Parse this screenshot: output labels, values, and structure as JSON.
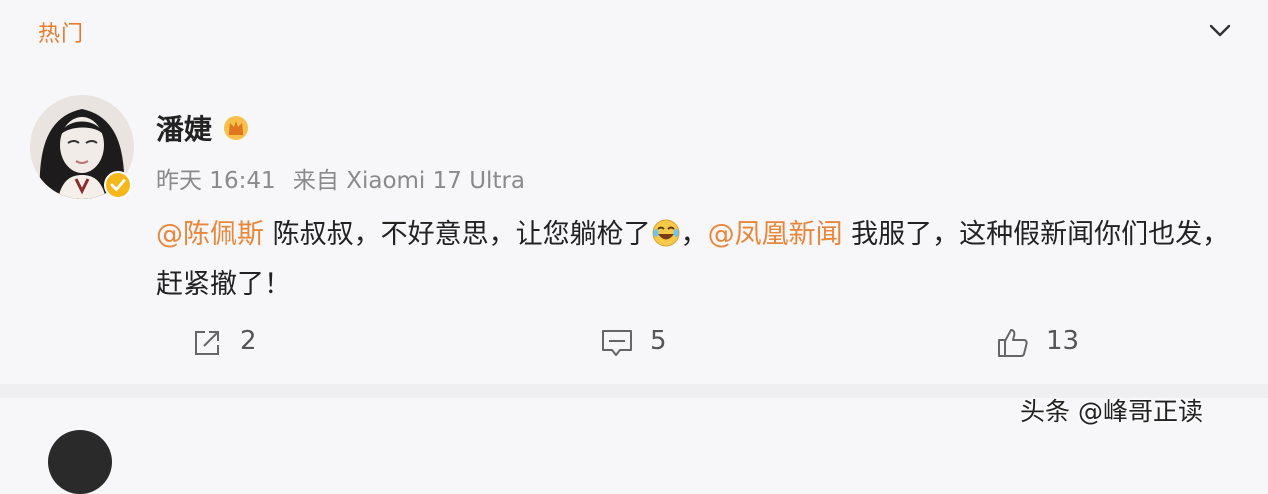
{
  "tabs": {
    "hot_label": "热门"
  },
  "post": {
    "username": "潘婕",
    "time": "昨天 16:41",
    "source": "来自 Xiaomi 17 Ultra",
    "segments": [
      {
        "type": "mention",
        "text": "@陈佩斯"
      },
      {
        "type": "text",
        "text": " 陈叔叔，不好意思，让您躺枪了"
      },
      {
        "type": "emoji",
        "name": "laughing-crying-emoji"
      },
      {
        "type": "text",
        "text": "，"
      },
      {
        "type": "mention",
        "text": "@凤凰新闻"
      },
      {
        "type": "text",
        "text": " 我服了，这种假新闻你们也发，赶紧撤了！"
      }
    ],
    "actions": {
      "share_count": "2",
      "comment_count": "5",
      "like_count": "13"
    }
  },
  "watermark": "头条 @峰哥正读",
  "colors": {
    "accent": "#e8873a",
    "text": "#222222",
    "meta": "#8a8a8a",
    "background": "#f7f7f9"
  },
  "icons": [
    "chevron-down-icon",
    "crown-icon",
    "verified-badge-icon",
    "share-icon",
    "comment-icon",
    "like-icon"
  ]
}
